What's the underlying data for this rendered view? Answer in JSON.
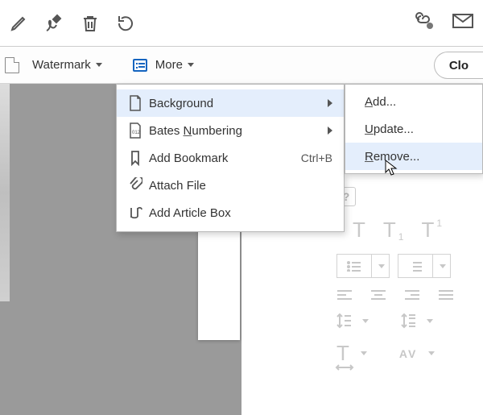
{
  "toolbar": {
    "watermark_label": "Watermark",
    "more_label": "More",
    "close_label": "Clo"
  },
  "more_menu": {
    "items": [
      {
        "label_pre": "Background",
        "mn": "",
        "label_post": "",
        "has_sub": true
      },
      {
        "label_pre": "Bates ",
        "mn": "N",
        "label_post": "umbering",
        "has_sub": true
      },
      {
        "label_pre": "Add Bookmark",
        "mn": "",
        "label_post": "",
        "accel": "Ctrl+B"
      },
      {
        "label_pre": "Attach File",
        "mn": "",
        "label_post": ""
      },
      {
        "label_pre": "Add Article Box",
        "mn": "",
        "label_post": ""
      }
    ]
  },
  "sub_menu": {
    "items": [
      {
        "mn": "A",
        "rest": "dd..."
      },
      {
        "mn": "U",
        "rest": "pdate..."
      },
      {
        "mn": "R",
        "rest": "emove..."
      }
    ]
  },
  "fmt": {
    "help": "?",
    "T": "T",
    "T1": "1",
    "AV": "AV"
  }
}
